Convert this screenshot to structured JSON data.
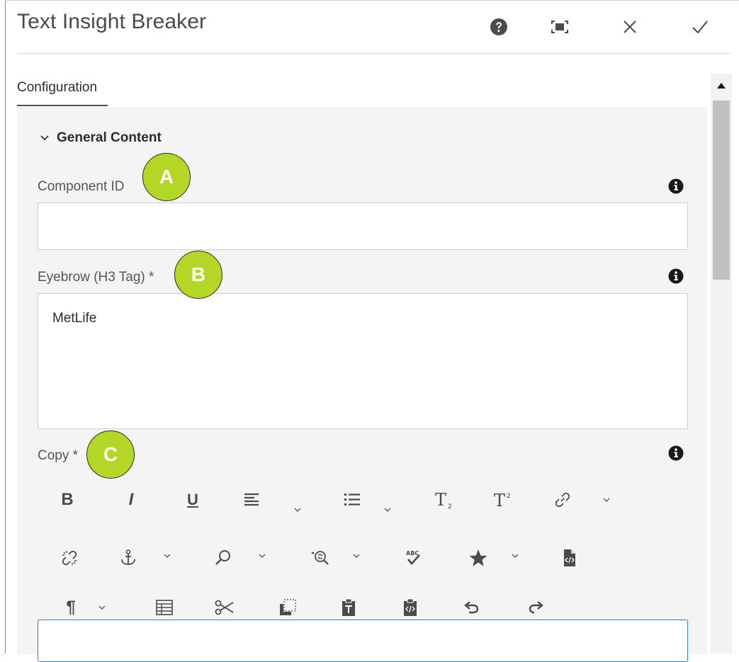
{
  "dialog": {
    "title": "Text Insight Breaker",
    "header_icons": [
      "help-icon",
      "fullscreen-icon",
      "close-icon",
      "done-check-icon"
    ]
  },
  "tabs": [
    {
      "label": "Configuration",
      "selected": true
    }
  ],
  "section": {
    "title": "General Content",
    "expanded": true
  },
  "fields": {
    "component_id": {
      "label": "Component ID",
      "value": ""
    },
    "eyebrow": {
      "label": "Eyebrow (H3 Tag) *",
      "value": "MetLife"
    },
    "copy": {
      "label": "Copy *",
      "value": ""
    }
  },
  "annotations": {
    "a": "A",
    "b": "B",
    "c": "C"
  },
  "toolbar": {
    "row1": [
      "bold",
      "italic",
      "underline",
      "justify",
      "lists",
      "subscript",
      "superscript",
      "link"
    ],
    "row2": [
      "unlink",
      "anchor",
      "find",
      "find-replace",
      "spellcheck",
      "special-chars",
      "source-edit"
    ],
    "row3": [
      "paragraph-format",
      "table",
      "cut",
      "copy",
      "paste",
      "paste-as-text",
      "undo",
      "redo"
    ],
    "labels": {
      "bold": "B",
      "italic": "I",
      "underline": "U",
      "paragraph": "¶",
      "abc": "ABC"
    }
  },
  "colors": {
    "badge": "#b2d825",
    "focus_border": "#2680eb",
    "panel": "#f4f4f4"
  }
}
